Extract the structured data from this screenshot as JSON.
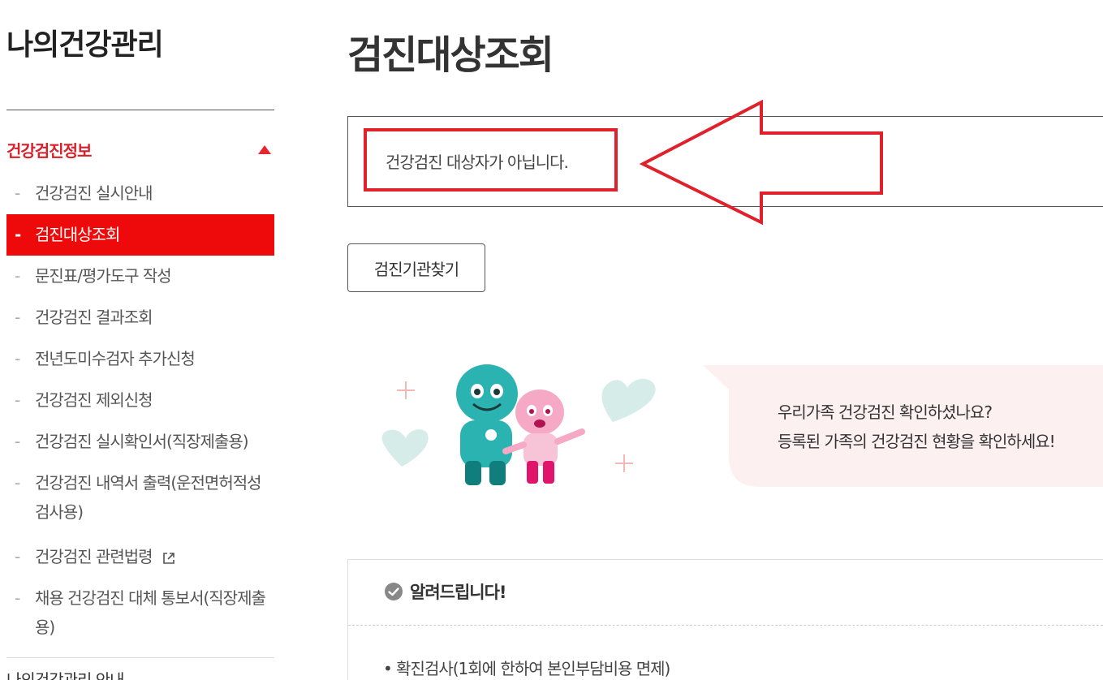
{
  "sidebar": {
    "title": "나의건강관리",
    "section": {
      "label": "건강검진정보",
      "expanded": true
    },
    "items": [
      {
        "label": "건강검진 실시안내"
      },
      {
        "label": "검진대상조회",
        "active": true
      },
      {
        "label": "문진표/평가도구 작성"
      },
      {
        "label": "건강검진 결과조회"
      },
      {
        "label": "전년도미수검자 추가신청"
      },
      {
        "label": "건강검진 제외신청"
      },
      {
        "label": "건강검진 실시확인서(직장제출용)"
      },
      {
        "label": "건강검진 내역서 출력(운전면허적성검사용)"
      },
      {
        "label": "건강검진 관련법령"
      },
      {
        "label": "채용 건강검진 대체 통보서(직장제출용)"
      }
    ],
    "dash": "-",
    "next_section": "나의건강관리 안내"
  },
  "main": {
    "title": "검진대상조회",
    "result_message": "건강검진 대상자가 아닙니다.",
    "find_button": "검진기관찾기",
    "promo": {
      "line1": "우리가족 건강검진 확인하셨나요?",
      "line2": "등록된 가족의 건강검진 현황을 확인하세요!"
    },
    "notice": {
      "title": "알려드립니다!",
      "items": [
        "• 확진검사(1회에 한하여 본인부담비용 면제)"
      ]
    }
  },
  "colors": {
    "accent_red": "#ee0a0a",
    "section_red": "#d8202a",
    "arrow_red": "#e0202a",
    "teal_character": "#2bb3b1",
    "pink_character": "#f5a9c4",
    "bubble_bg": "#fdf0f0"
  },
  "icons": {
    "section_toggle": "triangle-up-icon",
    "external_link": "external-link-icon",
    "notice_check": "check-circle-icon"
  }
}
